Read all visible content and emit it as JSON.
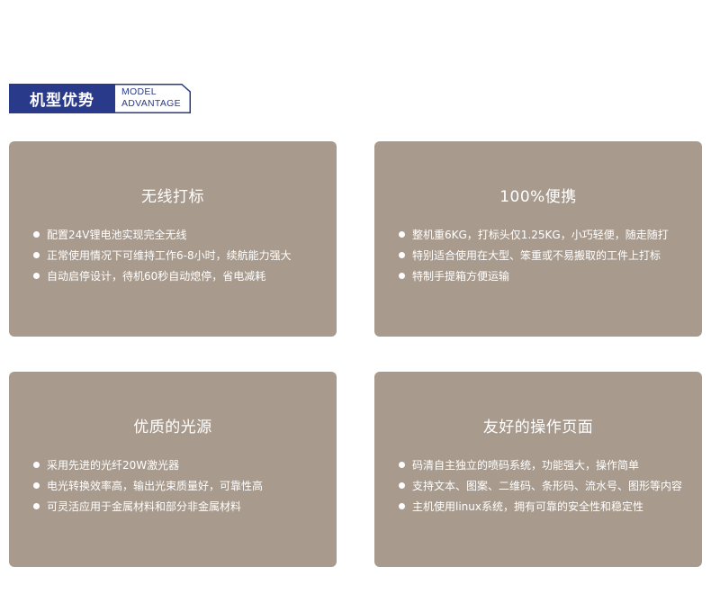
{
  "header": {
    "title_cn": "机型优势",
    "title_en_line1": "MODEL",
    "title_en_line2": "ADVANTAGE",
    "accent_color": "#2a3a8a"
  },
  "cards": [
    {
      "title": "无线打标",
      "items": [
        "配置24V锂电池实现完全无线",
        "正常使用情况下可维持工作6-8小时，续航能力强大",
        "自动启停设计，待机60秒自动熄停，省电减耗"
      ]
    },
    {
      "title": "100%便携",
      "items": [
        "整机重6KG，打标头仅1.25KG，小巧轻便，随走随打",
        "特别适合使用在大型、笨重或不易搬取的工件上打标",
        "特制手提箱方便运输"
      ]
    },
    {
      "title": "优质的光源",
      "items": [
        "采用先进的光纤20W激光器",
        "电光转换效率高，输出光束质量好，可靠性高",
        "可灵活应用于金属材料和部分非金属材料"
      ]
    },
    {
      "title": "友好的操作页面",
      "items": [
        "码清自主独立的喷码系统，功能强大，操作简单",
        "支持文本、图案、二维码、条形码、流水号、图形等内容",
        "主机使用linux系统，拥有可靠的安全性和稳定性"
      ]
    }
  ],
  "card_color": "#a89b8e"
}
